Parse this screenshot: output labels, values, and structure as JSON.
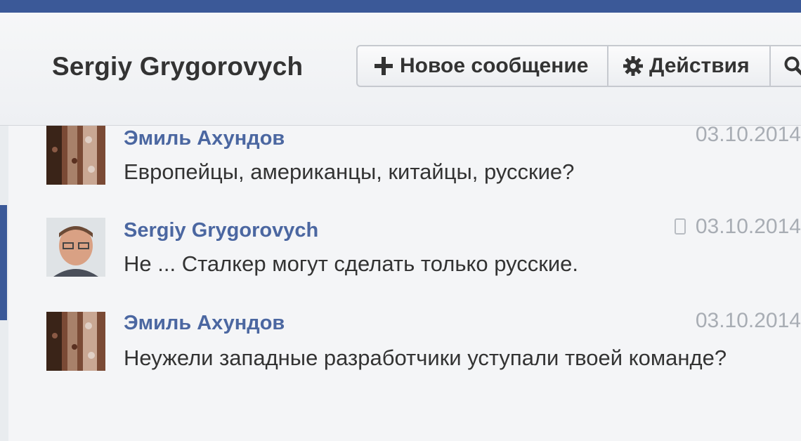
{
  "header": {
    "title": "Sergiy Grygorovych",
    "new_message_label": "Новое сообщение",
    "actions_label": "Действия"
  },
  "messages": [
    {
      "sender": "Эмиль Ахундов",
      "date": "03.10.2014",
      "text": "Европейцы, американцы, китайцы, русские?",
      "avatar": "pattern-avatar",
      "mobile": false
    },
    {
      "sender": "Sergiy Grygorovych",
      "date": "03.10.2014",
      "text": "Не ... Сталкер могут сделать только русские.",
      "avatar": "portrait-avatar",
      "mobile": true
    },
    {
      "sender": "Эмиль Ахундов",
      "date": "03.10.2014",
      "text": "Неужели западные разработчики уступали твоей команде?",
      "avatar": "pattern-avatar",
      "mobile": false
    }
  ],
  "colors": {
    "brand": "#3b5998",
    "name_link": "#4b67a1",
    "date": "#a8adb4",
    "text": "#333333"
  },
  "icons": [
    "plus-icon",
    "gear-icon",
    "search-icon",
    "mobile-icon"
  ]
}
